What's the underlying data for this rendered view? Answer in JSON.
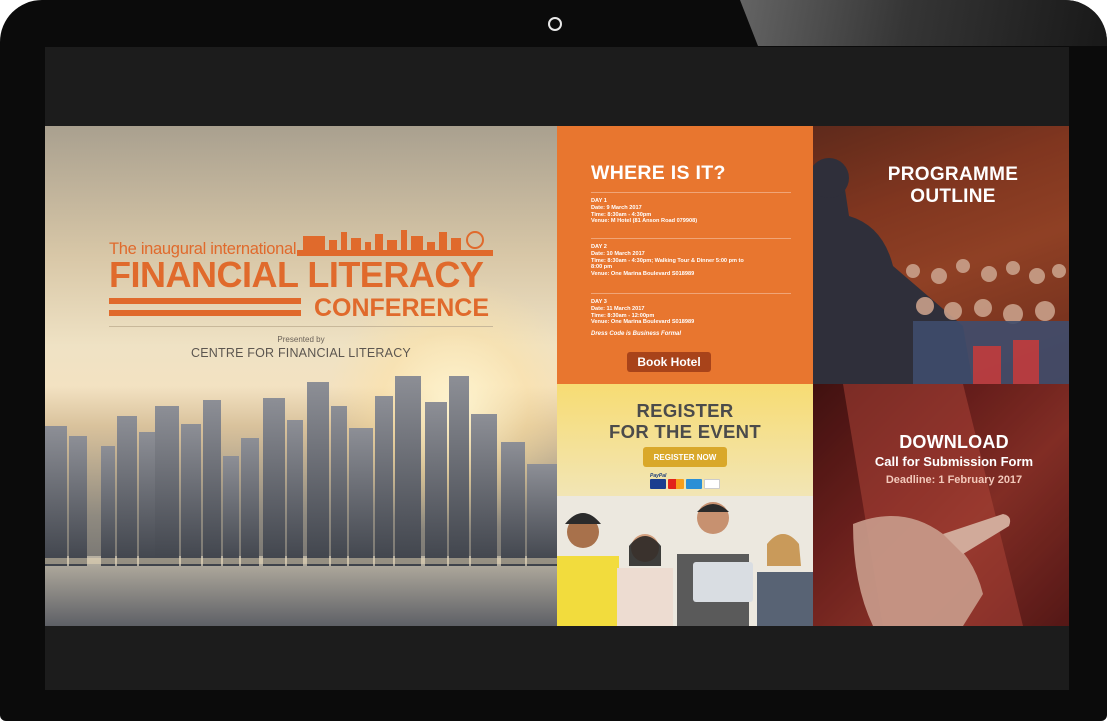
{
  "hero": {
    "tagline": "The inaugural international",
    "title": "FINANCIAL LITERACY",
    "subtitle": "CONFERENCE",
    "presented_by": "Presented by",
    "organizer": "CENTRE FOR FINANCIAL LITERACY"
  },
  "where": {
    "heading": "WHERE IS IT?",
    "days": [
      {
        "label": "DAY 1",
        "lines": [
          "Date: 9 March 2017",
          "Time: 8:30am - 4:30pm",
          "Venue: M Hotel (81 Anson Road 079908)"
        ]
      },
      {
        "label": "DAY 2",
        "lines": [
          "Date: 10 March 2017",
          "Time: 8:30am - 4:30pm; Walking Tour & Dinner 5:00 pm to",
          "8:00 pm",
          "Venue: One Marina Boulevard S018989"
        ]
      },
      {
        "label": "DAY 3",
        "lines": [
          "Date: 11 March 2017",
          "Time: 8:30am - 12:00pm",
          "Venue: One Marina Boulevard S018989"
        ]
      }
    ],
    "dress_code": "Dress Code is Business Formal",
    "button": "Book Hotel"
  },
  "programme": {
    "line1": "PROGRAMME",
    "line2": "OUTLINE"
  },
  "register": {
    "line1": "REGISTER",
    "line2": "FOR THE EVENT",
    "button": "REGISTER NOW",
    "payment_provider": "PayPal",
    "cards": [
      "VISA",
      "MasterCard",
      "Amex",
      "Discover"
    ]
  },
  "download": {
    "line1": "DOWNLOAD",
    "line2": "Call for Submission Form",
    "line3": "Deadline: 1 February 2017"
  },
  "colors": {
    "accent_orange": "#e8762f",
    "logo_orange": "#e06a2c",
    "book_button": "#a8431a",
    "register_button": "#d9a82a"
  }
}
